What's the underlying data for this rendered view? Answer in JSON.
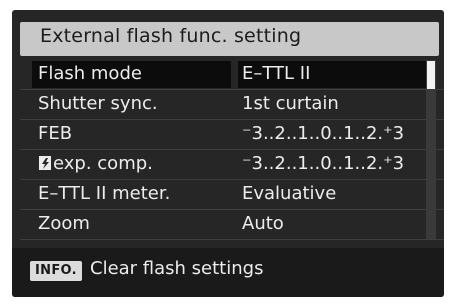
{
  "title": "External flash func. setting",
  "menu": {
    "items": [
      {
        "label": "Flash mode",
        "value": "E–TTL II"
      },
      {
        "label": "Shutter sync.",
        "value": "1st curtain"
      },
      {
        "label": "FEB",
        "value": "⁻3..2..1..0..1..2.⁺3"
      },
      {
        "label": "exp. comp.",
        "value": "⁻3..2..1..0..1..2.⁺3"
      },
      {
        "label": "E–TTL II meter.",
        "value": "Evaluative"
      },
      {
        "label": "Zoom",
        "value": "Auto"
      }
    ],
    "selected_index": 0,
    "flash_icon": "flash-exposure-compensation-icon"
  },
  "footer": {
    "info_button_label": "INFO.",
    "action_text": "Clear flash settings"
  },
  "colors": {
    "screen_bg": "#262626",
    "title_bar": "#c8c8c8",
    "selected_bg": "#0c0c0c",
    "text": "#ececec"
  }
}
